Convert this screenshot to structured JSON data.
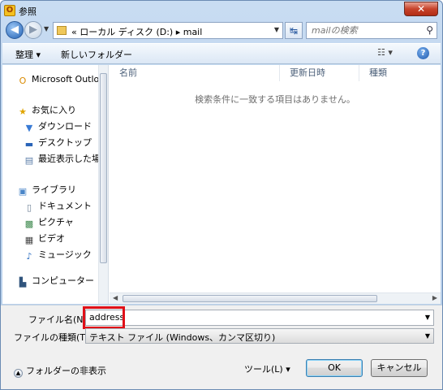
{
  "window": {
    "title": "参照",
    "close_glyph": "✕",
    "app_icon_glyph": "O"
  },
  "address": {
    "back_glyph": "◀",
    "forward_glyph": "▶",
    "path": "« ローカル ディスク (D:) ▸ mail",
    "refresh_glyph": "↹",
    "search_placeholder": "mailの検索",
    "search_icon": "magnifier-icon"
  },
  "toolbar": {
    "organize_label": "整理 ▾",
    "new_folder_label": "新しいフォルダー",
    "view_label": "☷ ▾",
    "help_glyph": "?"
  },
  "nav_pane": {
    "items": [
      {
        "label": "Microsoft Outlook",
        "icon": "outlook-icon",
        "glyph": "O",
        "color": "#d98a00"
      },
      {
        "label": "お気に入り",
        "icon": "star-icon",
        "glyph": "★",
        "color": "#e0a400"
      },
      {
        "label": "ダウンロード",
        "icon": "download-folder-icon",
        "glyph": "▼",
        "color": "#3a7bd5"
      },
      {
        "label": "デスクトップ",
        "icon": "desktop-icon",
        "glyph": "▬",
        "color": "#2a64b8"
      },
      {
        "label": "最近表示した場所",
        "icon": "recent-places-icon",
        "glyph": "▤",
        "color": "#5b7ea8"
      },
      {
        "label": "ライブラリ",
        "icon": "library-icon",
        "glyph": "▣",
        "color": "#4a86c8"
      },
      {
        "label": "ドキュメント",
        "icon": "document-icon",
        "glyph": "▯",
        "color": "#6c7f96"
      },
      {
        "label": "ピクチャ",
        "icon": "picture-icon",
        "glyph": "▩",
        "color": "#3f8a4f"
      },
      {
        "label": "ビデオ",
        "icon": "video-icon",
        "glyph": "▦",
        "color": "#444444"
      },
      {
        "label": "ミュージック",
        "icon": "music-icon",
        "glyph": "♪",
        "color": "#2d6fc2"
      },
      {
        "label": "コンピューター",
        "icon": "computer-icon",
        "glyph": "▙",
        "color": "#30547c"
      }
    ]
  },
  "file_pane": {
    "columns": [
      "名前",
      "更新日時",
      "種類"
    ],
    "empty_message": "検索条件に一致する項目はありません。"
  },
  "form": {
    "filename_label": "ファイル名(N):",
    "filename_value": "address",
    "filetype_label": "ファイルの種類(T):",
    "filetype_value": "テキスト ファイル (Windows、カンマ区切り)",
    "hide_folders_label": "フォルダーの非表示",
    "tools_label": "ツール(L)  ▾",
    "ok_label": "OK",
    "cancel_label": "キャンセル",
    "highlight_color": "#e01018"
  }
}
